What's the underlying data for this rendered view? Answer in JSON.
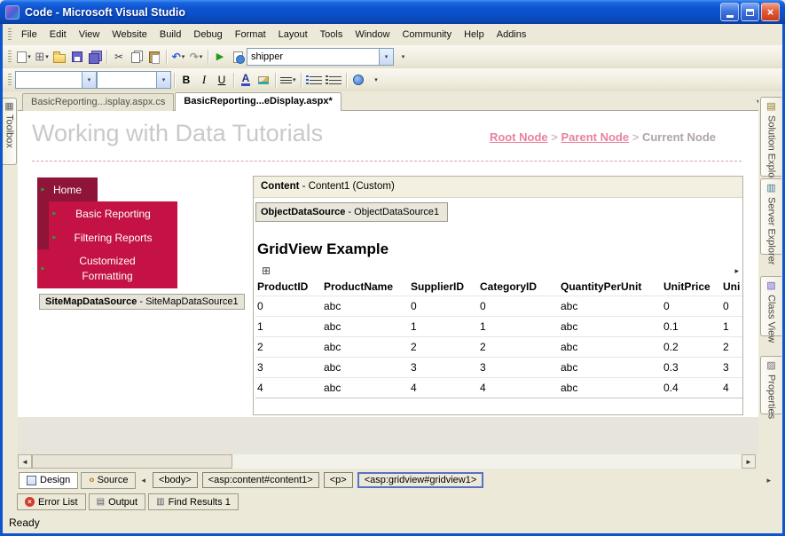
{
  "window": {
    "title": "Code - Microsoft Visual Studio",
    "status": "Ready"
  },
  "menubar": {
    "items": [
      "File",
      "Edit",
      "View",
      "Website",
      "Build",
      "Debug",
      "Format",
      "Layout",
      "Tools",
      "Window",
      "Community",
      "Help",
      "Addins"
    ]
  },
  "toolbar": {
    "find_value": "shipper"
  },
  "formatting": {
    "bold": "B",
    "italic": "I",
    "underline": "U",
    "font_color": "A"
  },
  "document_tabs": {
    "tab1": "BasicReporting...isplay.aspx.cs",
    "tab2": "BasicReporting...eDisplay.aspx*"
  },
  "side_tabs": {
    "left": [
      "Toolbox"
    ],
    "right": [
      "Solution Explorer",
      "Server Explorer",
      "Class View",
      "Properties"
    ]
  },
  "designer": {
    "page_title": "Working with Data Tutorials",
    "breadcrumb": {
      "root": "Root Node",
      "sep1": ">",
      "parent": "Parent Node",
      "sep2": ">",
      "current": "Current Node"
    },
    "nav_menu": {
      "items": [
        "Home",
        "Basic Reporting",
        "Filtering Reports",
        "Customized Formatting"
      ]
    },
    "sitemap_datasource": {
      "bold": "SiteMapDataSource",
      "rest": " - SiteMapDataSource1"
    },
    "content_panel": {
      "bold": "Content",
      "rest": " - Content1 (Custom)"
    },
    "object_datasource": {
      "bold": "ObjectDataSource",
      "rest": " - ObjectDataSource1"
    },
    "gridview_title": "GridView Example",
    "grid": {
      "columns": [
        "ProductID",
        "ProductName",
        "SupplierID",
        "CategoryID",
        "QuantityPerUnit",
        "UnitPrice",
        "Uni"
      ],
      "rows": [
        [
          "0",
          "abc",
          "0",
          "0",
          "abc",
          "0",
          "0"
        ],
        [
          "1",
          "abc",
          "1",
          "1",
          "abc",
          "0.1",
          "1"
        ],
        [
          "2",
          "abc",
          "2",
          "2",
          "abc",
          "0.2",
          "2"
        ],
        [
          "3",
          "abc",
          "3",
          "3",
          "abc",
          "0.3",
          "3"
        ],
        [
          "4",
          "abc",
          "4",
          "4",
          "abc",
          "0.4",
          "4"
        ]
      ]
    }
  },
  "view_switch": {
    "design": "Design",
    "source": "Source",
    "tags": [
      "<body>",
      "<asp:content#content1>",
      "<p>",
      "<asp:gridview#gridview1>"
    ]
  },
  "bottom_panels": [
    "Error List",
    "Output",
    "Find Results 1"
  ],
  "icons": {
    "caret_down": "▾",
    "scissors": "✂",
    "undo": "↶",
    "redo": "↷",
    "play": "▶",
    "grid_plus": "⊞",
    "smart_arrow": "▸",
    "tagnav_left": "◂",
    "tagnav_right": "▸",
    "nav_glyph": "►",
    "scroll_left": "◄",
    "scroll_right": "►",
    "close": "×",
    "dropdown": "▾",
    "solution_explorer": "▤",
    "server_explorer": "▥",
    "class_view": "▧",
    "properties": "▨",
    "toolbox": "▦",
    "output": "▤",
    "find": "▥",
    "angle_brackets": "‹›"
  },
  "colors": {
    "titlebar_blue": "#0D56CE",
    "nav_dark_red": "#8E1537",
    "nav_crimson": "#C31243",
    "breadcrumb_pink": "#E8829E",
    "chrome_beige": "#ECE9D8",
    "heading_gray": "#C9C9C9"
  }
}
